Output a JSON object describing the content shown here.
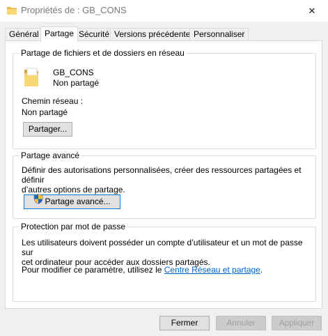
{
  "window": {
    "title": "Propriétés de : GB_CONS",
    "close_glyph": "✕"
  },
  "tabs": [
    {
      "label": "Général"
    },
    {
      "label": "Partage"
    },
    {
      "label": "Sécurité"
    },
    {
      "label": "Versions précédentes"
    },
    {
      "label": "Personnaliser"
    }
  ],
  "active_tab": "Partage",
  "network_sharing": {
    "legend": "Partage de fichiers et de dossiers en réseau",
    "folder_name": "GB_CONS",
    "folder_status": "Non partagé",
    "path_label": "Chemin réseau :",
    "path_value": "Non partagé",
    "share_button": "Partager..."
  },
  "advanced_sharing": {
    "legend": "Partage avancé",
    "description_line1": "Définir des autorisations personnalisées, créer des ressources partagées et définir",
    "description_line2": "d’autres options de partage.",
    "button": "Partage avancé..."
  },
  "password_protection": {
    "legend": "Protection par mot de passe",
    "description_line1": "Les utilisateurs doivent posséder un compte d’utilisateur et un mot de passe sur",
    "description_line2": "cet ordinateur pour accéder aux dossiers partagés.",
    "change_prefix": "Pour modifier ce paramètre, utilisez le ",
    "link": "Centre Réseau et partage",
    "change_suffix": "."
  },
  "footer": {
    "close_button": "Fermer",
    "cancel_button": "Annuler",
    "apply_button": "Appliquer"
  },
  "icons": {
    "title": "folder-icon",
    "folder": "folder-icon",
    "shield": "uac-shield-icon",
    "close": "close-icon"
  }
}
